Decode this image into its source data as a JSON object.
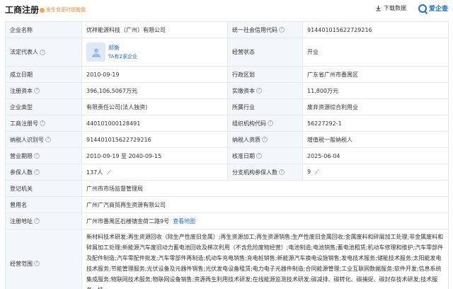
{
  "header": {
    "title": "工商注册",
    "notice": "发生变更时提醒我",
    "download_label": "下载数据",
    "brand": "爱企查"
  },
  "rows": [
    {
      "l1": "企业名称",
      "v1": "优祥能源科技（广州）有限公司",
      "l2": "统一社会信用代码",
      "v2": "91440101562272921​6"
    },
    {
      "l1": "法定代表人",
      "rep_name": "郑衡",
      "rep_sub": "TA有2家企业",
      "l2": "经营状态",
      "v2": "开业"
    },
    {
      "l1": "成立日期",
      "v1": "2010-09-19",
      "l2": "行政区划",
      "v2": "广东省广州市番禺区"
    },
    {
      "l1": "注册资本",
      "v1": "396,106.5067万元",
      "l2": "实缴资本",
      "v2": "11,800万元"
    },
    {
      "l1": "企业类型",
      "v1": "有限责任公司(法人独资)",
      "l2": "所属行业",
      "v2": "废弃资源综合利用业"
    },
    {
      "l1": "工商注册号",
      "v1": "440101000128491",
      "l2": "组织机构代码",
      "v2": "56227292-1"
    },
    {
      "l1": "纳税人识别号",
      "v1": "91440101562272921​6",
      "l2": "纳税人资质",
      "v2": "增值税一般纳税人"
    },
    {
      "l1": "营业期限",
      "v1": "2010-09-19 至 2040-09-15",
      "l2": "核准日期",
      "v2": "2025-06-04"
    },
    {
      "l1": "参保人数",
      "v1": "137人",
      "l2": "分支机构参保人数",
      "v2": "9"
    },
    {
      "l1": "登记机关",
      "v1": "广州市市场监督管理局"
    },
    {
      "l1": "曾用名",
      "v1": "广州广汽商贸再生资源有限公司"
    },
    {
      "l1": "注册地址",
      "v1": "广州市番禺区石楼镇金荷二路9号",
      "link": "查看地图"
    },
    {
      "l1": "经营范围",
      "v1": "新材料技术研发;再生资源回收（除生产性废旧金属）;再生资源加工;再生资源销售;生产性废旧金属回收;金属废料和碎屑加工处理;非金属废料和碎屑加工处理;新能源汽车废旧动力蓄电池回收及梯次利用（不含危险废物经营）;电池制造;电池销售;蓄电池租赁;机动车修理和维护;汽车零部件及配件制造;汽车零配件批发;汽车零部件再制造;机动车充电销售;充电桩销售;新能源汽车换电设施销售;发电技术服务;储能技术服务;太阳能发电技术服务;节能管理服务;光伏设备及元器件销售;光伏发电设备租赁;电力电子元器件制造;合同能源管理;工业互联网数据服务;软件开发;信息系统集成服务;物联网技术服务;物联网设备销售;资源再生利用技术研发;在线能源监测技术研发;碳减排、碳转化、碳捕捉、碳封存技术研发;技术服务、技"
    }
  ]
}
